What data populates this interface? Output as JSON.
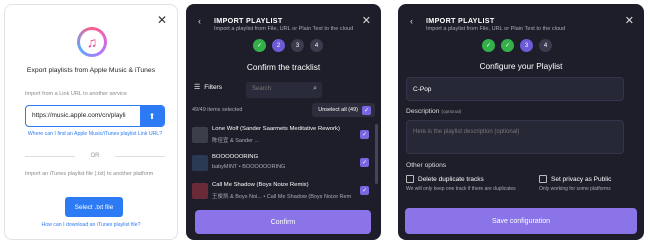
{
  "export_panel": {
    "title": "Export playlists from Apple Music & iTunes",
    "link_label": "Import from a Link URL to another service",
    "url_value": "https://music.apple.com/cn/playli",
    "link_help": "Where can I find an Apple Music/iTunes playlist Link URL?",
    "or_text": "OR",
    "file_label": "Import an iTunes playlist file (.txt) to another platform",
    "file_button": "Select .txt file",
    "file_help": "How can I download an iTunes playlist file?"
  },
  "tracklist_panel": {
    "title": "IMPORT PLAYLIST",
    "subtitle": "Import a playlist from File, URL or Plain Text to the cloud",
    "steps": [
      "✓",
      "2",
      "3",
      "4"
    ],
    "heading": "Confirm the tracklist",
    "filters_label": "Filters",
    "search_placeholder": "Search",
    "count_text": "49/49 items selected",
    "unselect_label": "Unselect all (49)",
    "tracks": [
      {
        "title": "Lone Wolf (Sander Saarmets Meditative Rework)",
        "artist": "陈佳宜 & Sander ...",
        "color": "#3b3f4a"
      },
      {
        "title": "BOOOOOORING",
        "artist": "babyMINT • BOOOOOORING",
        "color": "#2a3a55"
      },
      {
        "title": "Call Me Shadow (Boys Noize Remix)",
        "artist": "王俊凯 & Boys Noi... • Call Me Shadow (Boys Noize Rem",
        "color": "#6a2a38"
      }
    ],
    "confirm_label": "Confirm"
  },
  "configure_panel": {
    "title": "IMPORT PLAYLIST",
    "subtitle": "Import a playlist from File, URL or Plain Text to the cloud",
    "steps": [
      "✓",
      "✓",
      "3",
      "4"
    ],
    "heading": "Configure your Playlist",
    "name_value": "C-Pop",
    "description_label": "Description",
    "description_optional": "(optional)",
    "description_placeholder": "Here is the playlist description (optional)",
    "other_options_label": "Other options",
    "option1_label": "Delete duplicate tracks",
    "option1_help": "We will only keep one track if there are duplicates",
    "option2_label": "Set privacy as Public",
    "option2_help": "Only working for some platforms",
    "save_label": "Save configuration"
  },
  "icons": {
    "close": "close-icon",
    "back": "back-icon",
    "upload": "upload-icon",
    "search": "search-icon",
    "filter": "filter-icon",
    "check": "check-icon"
  },
  "colors": {
    "accent": "#8a74e8",
    "blue": "#2d7bf4",
    "success": "#33b04a",
    "dark_bg": "#1d1e2a"
  }
}
